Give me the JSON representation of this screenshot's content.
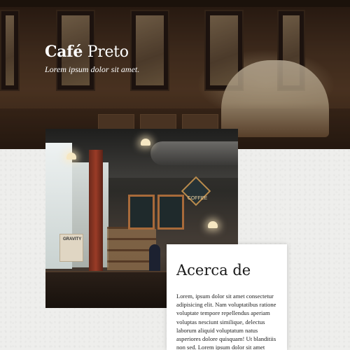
{
  "brand": {
    "name_strong": "Café",
    "name_rest": " Preto",
    "tagline": "Lorem ipsum dolor sit amet."
  },
  "photo": {
    "box_label": "GRAVITY",
    "sign_label": "COFFEE"
  },
  "about": {
    "title": "Acerca de",
    "body": "Lorem, ipsum dolor sit amet consectetur adipisicing elit. Nam voluptatibus ratione voluptate tempore repellendus aperiam voluptas nesciunt similique, delectus laborum aliquid voluptatum natus asperiores dolore quisquam! Ut blanditiis non sed. Lorem ipsum dolor sit amet consectetur adipisicing elit."
  },
  "colors": {
    "hero_dark": "#2a1b12",
    "paper": "#eeeeec",
    "card": "#ffffff",
    "text": "#1a1a1a"
  }
}
